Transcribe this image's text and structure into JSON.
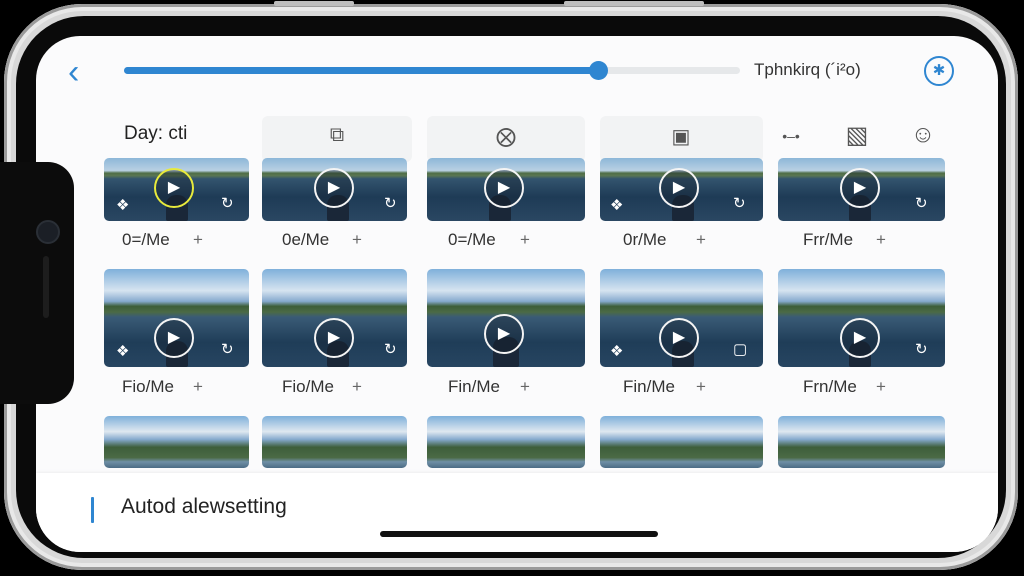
{
  "header": {
    "back_glyph": "‹",
    "progress_percent": 77,
    "status_text": "Tphnkirq (´i²o)",
    "action_icon": "bluetooth-icon",
    "action_glyph": "✱"
  },
  "toolbar": {
    "day_label": "Day: cti",
    "icons": [
      {
        "name": "camera-tab-icon",
        "glyph": "⧉"
      },
      {
        "name": "switch-tab-icon",
        "glyph": "⨂"
      },
      {
        "name": "video-tab-icon",
        "glyph": "▣"
      },
      {
        "name": "dots-tab-icon",
        "glyph": "•‒•"
      },
      {
        "name": "chip-icon",
        "glyph": "▧"
      },
      {
        "name": "profile-icon",
        "glyph": "☺"
      }
    ]
  },
  "grid": {
    "row1_captions": [
      "0=/Me",
      "0e/Me",
      "0=/Me",
      "0r/Me",
      "Frr/Me"
    ],
    "row2_captions": [
      "Fio/Me",
      "Fio/Me",
      "Fin/Me",
      "Fin/Me",
      "Frn/Me"
    ],
    "plus_glyph": "+",
    "play_glyph": "▶"
  },
  "bottom": {
    "label": "Autod alewsetting"
  },
  "colors": {
    "accent": "#2f86d1",
    "highlight": "#e8ea3c"
  }
}
